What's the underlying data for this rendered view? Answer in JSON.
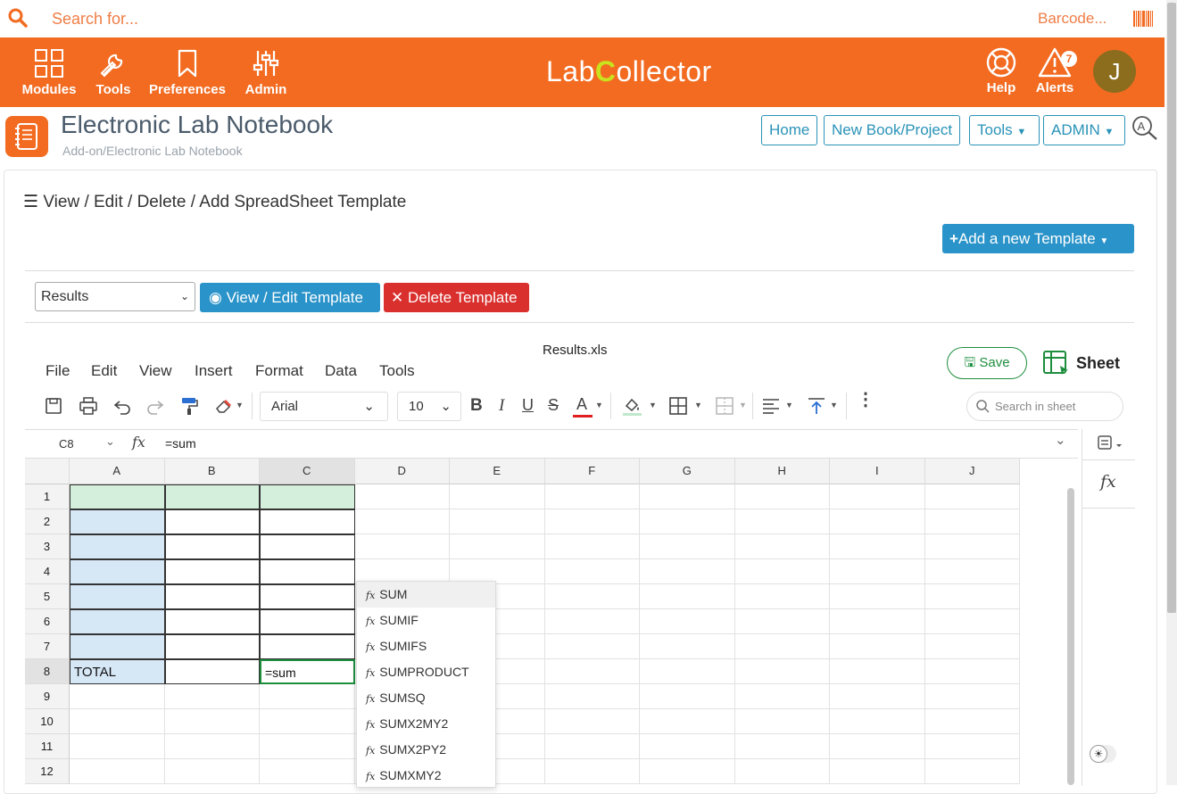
{
  "search": {
    "placeholder": "Search for...",
    "barcode_label": "Barcode..."
  },
  "nav": {
    "items": [
      {
        "label": "Modules",
        "icon": "grid-icon"
      },
      {
        "label": "Tools",
        "icon": "wrench-icon"
      },
      {
        "label": "Preferences",
        "icon": "bookmark-icon"
      },
      {
        "label": "Admin",
        "icon": "sliders-icon"
      }
    ],
    "logo_a": "Lab",
    "logo_c": "C",
    "logo_b": "ollector",
    "help_label": "Help",
    "alerts_label": "Alerts",
    "alerts_count": "7",
    "avatar_initial": "J"
  },
  "page": {
    "title": "Electronic Lab Notebook",
    "breadcrumb": "Add-on/Electronic Lab Notebook",
    "buttons": [
      "Home",
      "New Book/Project",
      "Tools",
      "ADMIN"
    ]
  },
  "section": {
    "title": "View / Edit / Delete / Add SpreadSheet Template",
    "add_template": "Add a new Template",
    "selected_template": "Results",
    "view_edit": "View / Edit Template",
    "delete": "Delete Template"
  },
  "sheet": {
    "filename": "Results.xls",
    "menus": [
      "File",
      "Edit",
      "View",
      "Insert",
      "Format",
      "Data",
      "Tools"
    ],
    "save_label": "Save",
    "sheet_label": "Sheet",
    "font": "Arial",
    "font_size": "10",
    "search_placeholder": "Search in sheet",
    "cell_ref": "C8",
    "formula": "=sum",
    "columns": [
      "A",
      "B",
      "C",
      "D",
      "E",
      "F",
      "G",
      "H",
      "I",
      "J"
    ],
    "rows": [
      "1",
      "2",
      "3",
      "4",
      "5",
      "6",
      "7",
      "8",
      "9",
      "10",
      "11",
      "12"
    ],
    "cells": {
      "A8": "TOTAL",
      "C8": "=sum"
    },
    "autocomplete": [
      "SUM",
      "SUMIF",
      "SUMIFS",
      "SUMPRODUCT",
      "SUMSQ",
      "SUMX2MY2",
      "SUMX2PY2",
      "SUMXMY2"
    ]
  },
  "colors": {
    "brand_orange": "#f26b21",
    "primary_blue": "#2a93c9",
    "danger_red": "#d9302e",
    "header_green": "#d4f0dc",
    "label_blue": "#d6e7f6"
  }
}
